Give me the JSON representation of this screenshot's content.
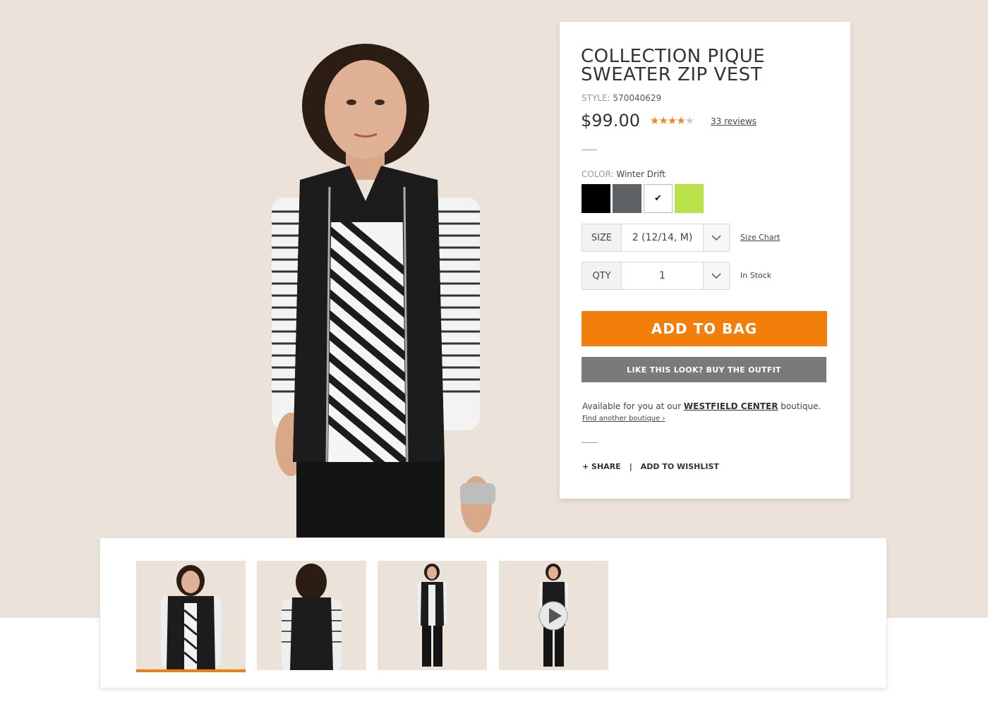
{
  "product": {
    "title": "COLLECTION PIQUE SWEATER ZIP VEST",
    "style_label": "STYLE:",
    "style_number": "570040629",
    "price": "$99.00",
    "rating": 4,
    "rating_max": 5,
    "reviews_label": "33 reviews"
  },
  "color": {
    "label": "COLOR:",
    "selected": "Winter Drift",
    "swatches": [
      {
        "name": "black",
        "hex": "#000000"
      },
      {
        "name": "charcoal",
        "hex": "#5f6264"
      },
      {
        "name": "winter-drift",
        "hex": "#ffffff",
        "selected": true
      },
      {
        "name": "lime",
        "hex": "#b8e14a"
      }
    ]
  },
  "size": {
    "label": "SIZE",
    "value": "2 (12/14, M)",
    "chart_link": "Size Chart"
  },
  "qty": {
    "label": "QTY",
    "value": "1",
    "stock": "In Stock"
  },
  "buttons": {
    "add_to_bag": "ADD TO BAG",
    "buy_outfit": "LIKE THIS LOOK? BUY THE OUTFIT"
  },
  "availability": {
    "prefix": "Available for you at our ",
    "store": "WESTFIELD CENTER",
    "suffix": " boutique.",
    "find_link": "Find another boutique ›"
  },
  "actions": {
    "share": "+ SHARE",
    "separator": "|",
    "wishlist": "ADD TO WISHLIST"
  },
  "thumbnails": [
    {
      "name": "front",
      "selected": true
    },
    {
      "name": "back"
    },
    {
      "name": "full-length"
    },
    {
      "name": "video",
      "icon": "play-icon"
    }
  ],
  "colors": {
    "accent": "#f27f0c",
    "background": "#ebe3d9",
    "secondary_button": "#7a7a7a"
  }
}
